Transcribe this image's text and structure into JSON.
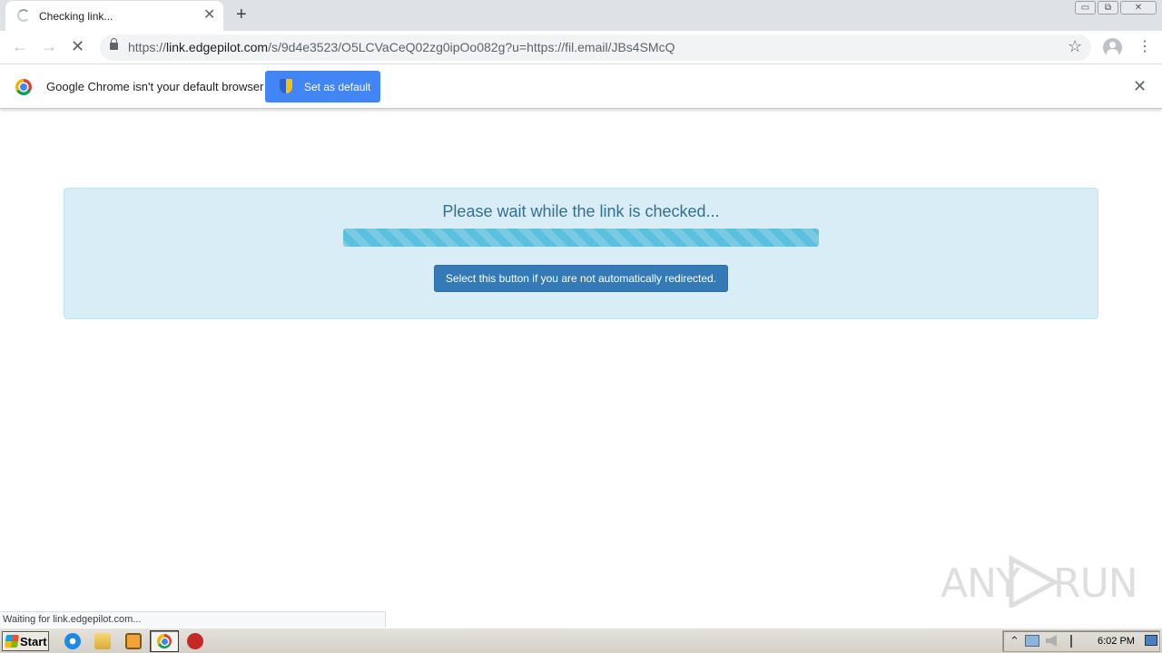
{
  "tab": {
    "title": "Checking link...",
    "close": "✕",
    "new_tab": "+"
  },
  "window_controls": {
    "minimize": "▭",
    "restore": "⧉",
    "close": "✕"
  },
  "toolbar": {
    "back_icon": "←",
    "forward_icon": "→",
    "reload_icon": "✕",
    "url_scheme": "https://",
    "url_host": "link.edgepilot.com",
    "url_path": "/s/9d4e3523/O5LCVaCeQ02zg0ipOo082g?u=https://fil.email/JBs4SMcQ",
    "star_icon": "☆",
    "menu_icon": "⋮"
  },
  "infobar": {
    "message": "Google Chrome isn't your default browser",
    "button_label": "Set as default",
    "close_icon": "✕"
  },
  "page": {
    "heading": "Please wait while the link is checked...",
    "progress_percent": 100,
    "redirect_button": "Select this button if you are not automatically redirected."
  },
  "status": {
    "text": "Waiting for link.edgepilot.com..."
  },
  "watermark": {
    "left": "ANY",
    "right": "RUN"
  },
  "taskbar": {
    "start_label": "Start",
    "clock": "6:02 PM",
    "tray_up_icon": "⌃",
    "colors": {
      "accent": "#337ab7",
      "panel": "#d9edf7",
      "progress": "#5bc0de"
    }
  }
}
